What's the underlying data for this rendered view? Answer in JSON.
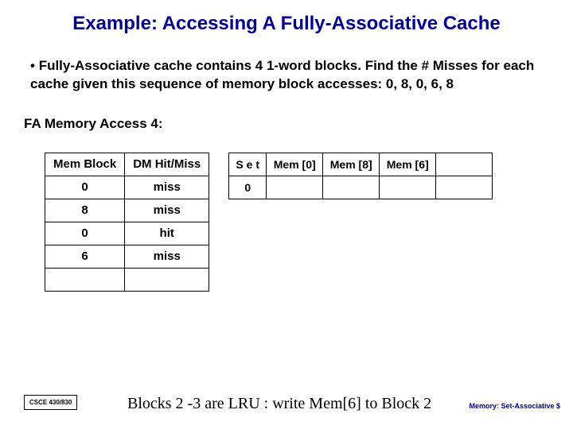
{
  "title": "Example: Accessing A Fully-Associative Cache",
  "bullet": "Fully-Associative cache contains 4 1-word blocks. Find the # Misses for each cache given this sequence of memory block accesses: 0, 8, 0, 6, 8",
  "subhead": "FA Memory Access 4:",
  "t1": {
    "h1": "Mem Block",
    "h2": "DM Hit/Miss",
    "r1c1": "0",
    "r1c2": "miss",
    "r2c1": "8",
    "r2c2": "miss",
    "r3c1": "0",
    "r3c2": "hit",
    "r4c1": "6",
    "r4c2": "miss"
  },
  "t2": {
    "h1": "S e t",
    "h2": "Mem [0]",
    "h3": "Mem [8]",
    "h4": "Mem [6]",
    "r1c1": "0"
  },
  "footnote": "CSCE 430/830",
  "conclusion": "Blocks 2 -3 are LRU : write Mem[6] to Block 2",
  "rightfoot": "Memory: Set-Associative $"
}
